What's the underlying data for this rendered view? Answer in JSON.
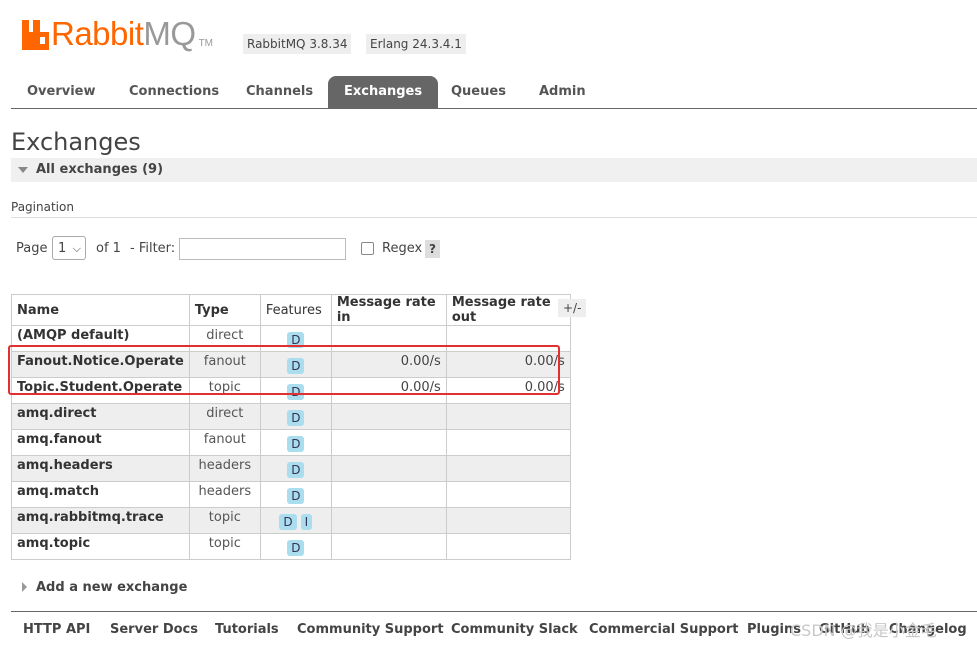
{
  "header": {
    "logo_rabbit": "Rabbit",
    "logo_mq": "MQ",
    "logo_tm": "TM",
    "rabbitmq_version": "RabbitMQ 3.8.34",
    "erlang_version": "Erlang 24.3.4.1",
    "brand_color": "#ff6600"
  },
  "nav": {
    "tabs": [
      "Overview",
      "Connections",
      "Channels",
      "Exchanges",
      "Queues",
      "Admin"
    ],
    "active": "Exchanges"
  },
  "page_title": "Exchanges",
  "section": {
    "label": "All exchanges (9)"
  },
  "pagination": {
    "section_label": "Pagination",
    "page_label": "Page",
    "page_value": "1",
    "of_label": "of 1",
    "filter_label": "- Filter:",
    "filter_value": "",
    "regex_label": "Regex",
    "regex_checked": false,
    "help_label": "?"
  },
  "table": {
    "headers": [
      "Name",
      "Type",
      "Features",
      "Message rate in",
      "Message rate out"
    ],
    "columns_toggle": "+/-",
    "rows": [
      {
        "name": "(AMQP default)",
        "type": "direct",
        "features": [
          "D"
        ],
        "rate_in": "",
        "rate_out": ""
      },
      {
        "name": "Fanout.Notice.Operate",
        "type": "fanout",
        "features": [
          "D"
        ],
        "rate_in": "0.00/s",
        "rate_out": "0.00/s"
      },
      {
        "name": "Topic.Student.Operate",
        "type": "topic",
        "features": [
          "D"
        ],
        "rate_in": "0.00/s",
        "rate_out": "0.00/s"
      },
      {
        "name": "amq.direct",
        "type": "direct",
        "features": [
          "D"
        ],
        "rate_in": "",
        "rate_out": ""
      },
      {
        "name": "amq.fanout",
        "type": "fanout",
        "features": [
          "D"
        ],
        "rate_in": "",
        "rate_out": ""
      },
      {
        "name": "amq.headers",
        "type": "headers",
        "features": [
          "D"
        ],
        "rate_in": "",
        "rate_out": ""
      },
      {
        "name": "amq.match",
        "type": "headers",
        "features": [
          "D"
        ],
        "rate_in": "",
        "rate_out": ""
      },
      {
        "name": "amq.rabbitmq.trace",
        "type": "topic",
        "features": [
          "D",
          "I"
        ],
        "rate_in": "",
        "rate_out": ""
      },
      {
        "name": "amq.topic",
        "type": "topic",
        "features": [
          "D"
        ],
        "rate_in": "",
        "rate_out": ""
      }
    ]
  },
  "add_exchange": {
    "label": "Add a new exchange"
  },
  "footer": {
    "links": [
      "HTTP API",
      "Server Docs",
      "Tutorials",
      "Community Support",
      "Community Slack",
      "Commercial Support",
      "Plugins",
      "GitHub",
      "Changelog"
    ]
  },
  "watermark": "CSDN @我是小金毛"
}
